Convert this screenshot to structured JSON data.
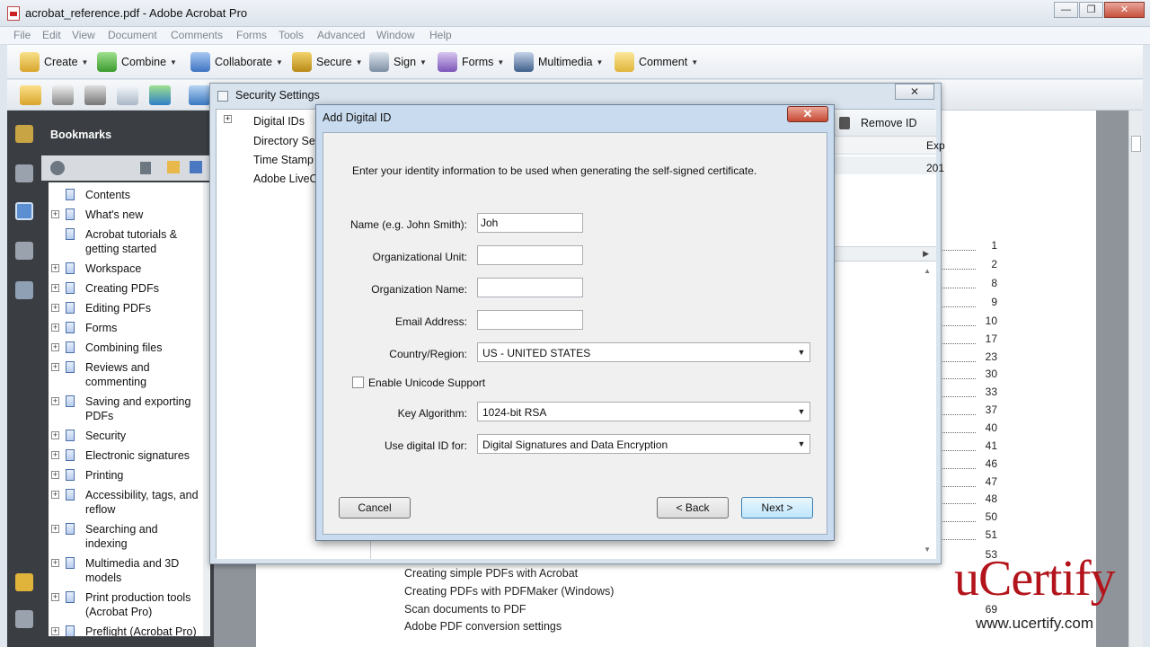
{
  "window": {
    "title": "acrobat_reference.pdf - Adobe Acrobat Pro"
  },
  "menu": [
    "File",
    "Edit",
    "View",
    "Document",
    "Comments",
    "Forms",
    "Tools",
    "Advanced",
    "Window",
    "Help"
  ],
  "toolbar": {
    "create": "Create",
    "combine": "Combine",
    "collaborate": "Collaborate",
    "secure": "Secure",
    "sign": "Sign",
    "forms": "Forms",
    "multimedia": "Multimedia",
    "comment": "Comment"
  },
  "bookmarks": {
    "header": "Bookmarks",
    "items": [
      {
        "label": "Contents",
        "expandable": false
      },
      {
        "label": "What's new",
        "expandable": true
      },
      {
        "label": "Acrobat tutorials & getting started",
        "expandable": false
      },
      {
        "label": "Workspace",
        "expandable": true
      },
      {
        "label": "Creating PDFs",
        "expandable": true
      },
      {
        "label": "Editing PDFs",
        "expandable": true
      },
      {
        "label": "Forms",
        "expandable": true
      },
      {
        "label": "Combining files",
        "expandable": true
      },
      {
        "label": "Reviews and commenting",
        "expandable": true
      },
      {
        "label": "Saving and exporting PDFs",
        "expandable": true
      },
      {
        "label": "Security",
        "expandable": true
      },
      {
        "label": "Electronic signatures",
        "expandable": true
      },
      {
        "label": "Printing",
        "expandable": true
      },
      {
        "label": "Accessibility, tags, and reflow",
        "expandable": true
      },
      {
        "label": "Searching and indexing",
        "expandable": true
      },
      {
        "label": "Multimedia and 3D models",
        "expandable": true
      },
      {
        "label": "Print production tools (Acrobat Pro)",
        "expandable": true
      },
      {
        "label": "Preflight (Acrobat Pro)",
        "expandable": true
      }
    ]
  },
  "security_settings": {
    "title": "Security Settings",
    "tree": [
      "Digital IDs",
      "Directory Serv",
      "Time Stamp S",
      "Adobe LiveCy"
    ],
    "remove_id": "Remove ID",
    "col_exp": "Exp",
    "exp_value": "201"
  },
  "dialog": {
    "title": "Add Digital ID",
    "intro": "Enter your identity information to be used when generating the self-signed certificate.",
    "name_label": "Name (e.g. John Smith):",
    "name_value": "Joh",
    "org_unit_label": "Organizational Unit:",
    "org_unit_value": "",
    "org_name_label": "Organization Name:",
    "org_name_value": "",
    "email_label": "Email Address:",
    "email_value": "",
    "country_label": "Country/Region:",
    "country_value": "US - UNITED STATES",
    "unicode_label": "Enable Unicode Support",
    "unicode_checked": false,
    "key_algo_label": "Key Algorithm:",
    "key_algo_value": "1024-bit RSA",
    "use_for_label": "Use digital ID for:",
    "use_for_value": "Digital Signatures and Data Encryption",
    "cancel": "Cancel",
    "back": "< Back",
    "next": "Next >"
  },
  "toc": {
    "numbers": [
      "1",
      "2",
      "8",
      "9",
      "10",
      "17",
      "23",
      "30",
      "33",
      "37",
      "40",
      "41",
      "46",
      "47",
      "48",
      "50",
      "51",
      "53",
      "69"
    ],
    "entries": [
      "Creating simple PDFs with Acrobat",
      "Creating PDFs with PDFMaker (Windows)",
      "Scan documents to PDF",
      "Adobe PDF conversion settings"
    ]
  },
  "watermark": {
    "brand": "uCertify",
    "url": "www.ucertify.com"
  },
  "colors": {
    "watermark": "#b3141c",
    "dialog_frame": "#c9dbee",
    "panel_dark": "#3b3e43"
  }
}
